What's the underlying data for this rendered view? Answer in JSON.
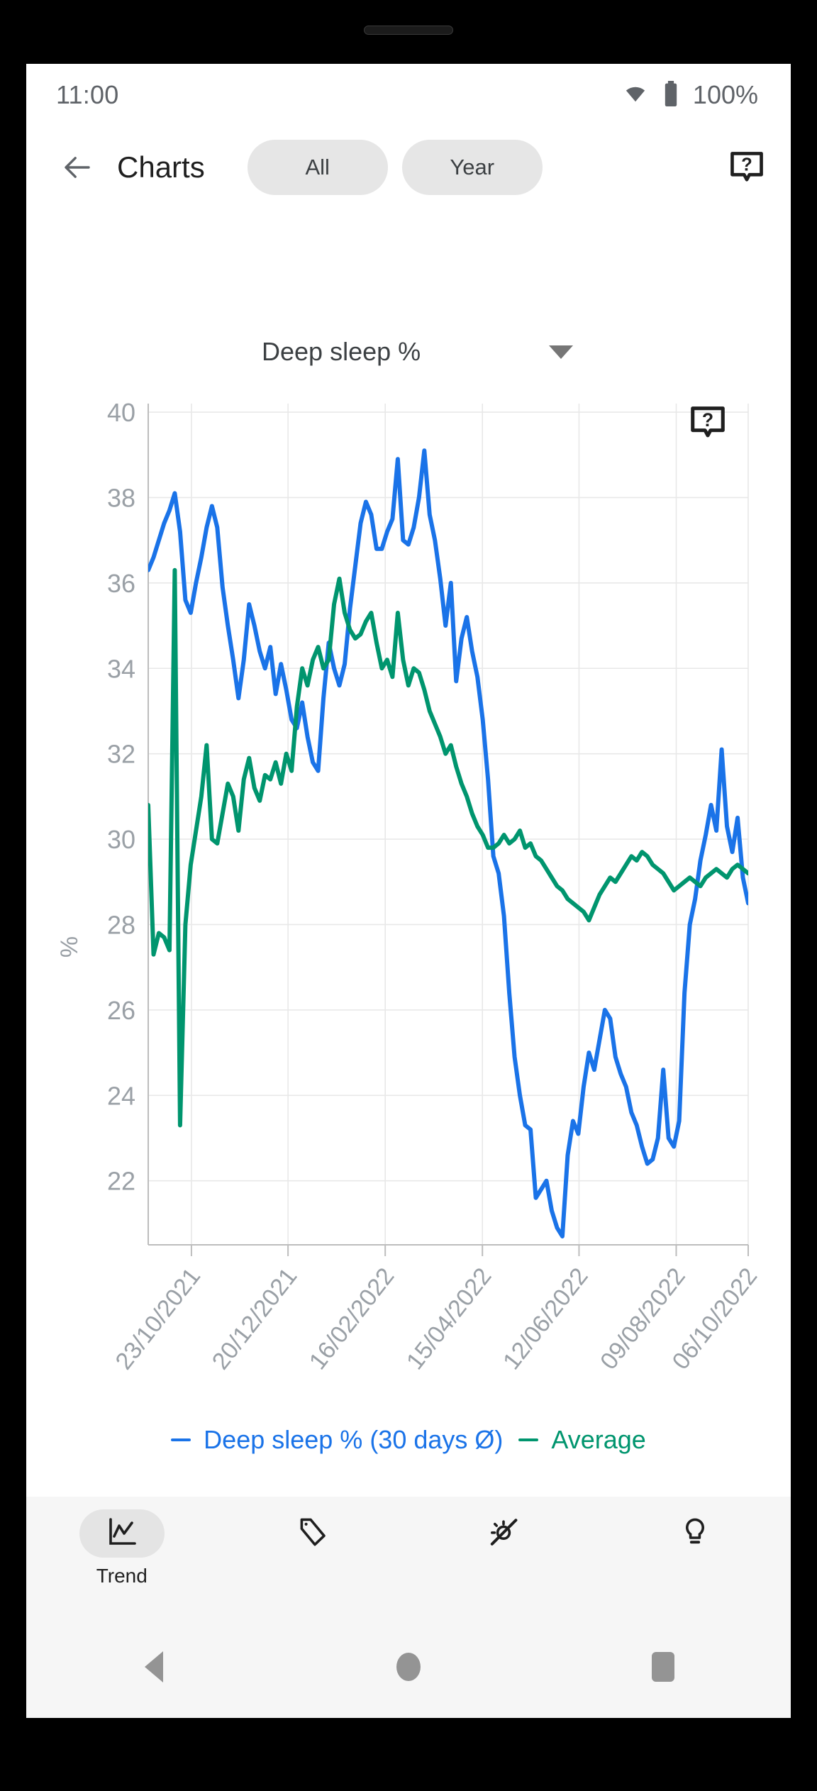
{
  "status_bar": {
    "clock": "11:00",
    "battery_percent": "100%",
    "wifi_icon": "wifi-icon",
    "battery_icon": "battery-full-icon"
  },
  "app_bar": {
    "back_icon": "back-arrow-icon",
    "title": "Charts",
    "range_buttons": [
      {
        "label": "All",
        "selected": false
      },
      {
        "label": "Year",
        "selected": false
      }
    ],
    "help_icon": "help-speech-bubble-icon"
  },
  "metric_selector": {
    "selected": "Deep sleep %",
    "caret_icon": "chevron-down-icon"
  },
  "chart_help": {
    "icon": "help-speech-bubble-icon"
  },
  "legend": [
    {
      "label": "Deep sleep % (30 days Ø)",
      "color": "#1a73e8"
    },
    {
      "label": "Average",
      "color": "#00956e"
    }
  ],
  "bottom_nav": {
    "items": [
      {
        "label": "Trend",
        "icon": "line-chart-icon",
        "selected": true
      },
      {
        "label": "",
        "icon": "tag-icon",
        "selected": false
      },
      {
        "label": "",
        "icon": "weather-sun-slash-icon",
        "selected": false
      },
      {
        "label": "",
        "icon": "lightbulb-icon",
        "selected": false
      }
    ]
  },
  "system_nav": {
    "back": "system-back-icon",
    "home": "system-home-icon",
    "recents": "system-recents-icon"
  },
  "colors": {
    "series_blue": "#1a73e8",
    "series_green": "#00956e",
    "grid": "#e8e8e8",
    "axis": "#bdbdbd",
    "tick_text": "#9aa0a6"
  },
  "chart_data": {
    "type": "line",
    "title": "Deep sleep %",
    "xlabel": "",
    "ylabel": "%",
    "ylim": [
      20.5,
      40.2
    ],
    "yticks": [
      40,
      38,
      36,
      34,
      32,
      30,
      28,
      26,
      24,
      22
    ],
    "grid": true,
    "legend_position": "bottom",
    "xticks": [
      "23/10/2021",
      "20/12/2021",
      "16/02/2022",
      "15/04/2022",
      "12/06/2022",
      "09/08/2022",
      "06/10/2022"
    ],
    "xtick_positions": [
      0.072,
      0.233,
      0.395,
      0.557,
      0.718,
      0.88,
      1.0
    ],
    "series": [
      {
        "name": "Deep sleep % (30 days Ø)",
        "color": "#1a73e8",
        "values": [
          36.3,
          36.6,
          37.0,
          37.4,
          37.7,
          38.1,
          37.2,
          35.6,
          35.3,
          36.0,
          36.6,
          37.3,
          37.8,
          37.3,
          35.9,
          35.0,
          34.2,
          33.3,
          34.2,
          35.5,
          35.0,
          34.4,
          34.0,
          34.5,
          33.4,
          34.1,
          33.5,
          32.8,
          32.6,
          33.2,
          32.4,
          31.8,
          31.6,
          33.3,
          34.6,
          34.0,
          33.6,
          34.1,
          35.4,
          36.4,
          37.4,
          37.9,
          37.6,
          36.8,
          36.8,
          37.2,
          37.5,
          38.9,
          37.0,
          36.9,
          37.3,
          38.0,
          39.1,
          37.6,
          37.0,
          36.1,
          35.0,
          36.0,
          33.7,
          34.7,
          35.2,
          34.4,
          33.8,
          32.8,
          31.4,
          29.6,
          29.2,
          28.2,
          26.4,
          24.9,
          24.0,
          23.3,
          23.2,
          21.6,
          21.8,
          22.0,
          21.3,
          20.9,
          20.7,
          22.6,
          23.4,
          23.1,
          24.2,
          25.0,
          24.6,
          25.3,
          26.0,
          25.8,
          24.9,
          24.5,
          24.2,
          23.6,
          23.3,
          22.8,
          22.4,
          22.5,
          23.0,
          24.6,
          23.0,
          22.8,
          23.4,
          26.4,
          28.0,
          28.6,
          29.5,
          30.1,
          30.8,
          30.2,
          32.1,
          30.3,
          29.7,
          30.5,
          29.1,
          28.5
        ]
      },
      {
        "name": "Average",
        "color": "#00956e",
        "values": [
          30.8,
          27.3,
          27.8,
          27.7,
          27.4,
          36.3,
          23.3,
          28.0,
          29.4,
          30.2,
          31.0,
          32.2,
          30.0,
          29.9,
          30.6,
          31.3,
          31.0,
          30.2,
          31.4,
          31.9,
          31.2,
          30.9,
          31.5,
          31.4,
          31.8,
          31.3,
          32.0,
          31.6,
          33.1,
          34.0,
          33.6,
          34.2,
          34.5,
          34.0,
          34.2,
          35.5,
          36.1,
          35.3,
          34.9,
          34.7,
          34.8,
          35.1,
          35.3,
          34.6,
          34.0,
          34.2,
          33.8,
          35.3,
          34.2,
          33.6,
          34.0,
          33.9,
          33.5,
          33.0,
          32.7,
          32.4,
          32.0,
          32.2,
          31.7,
          31.3,
          31.0,
          30.6,
          30.3,
          30.1,
          29.8,
          29.8,
          29.9,
          30.1,
          29.9,
          30.0,
          30.2,
          29.8,
          29.9,
          29.6,
          29.5,
          29.3,
          29.1,
          28.9,
          28.8,
          28.6,
          28.5,
          28.4,
          28.3,
          28.1,
          28.4,
          28.7,
          28.9,
          29.1,
          29.0,
          29.2,
          29.4,
          29.6,
          29.5,
          29.7,
          29.6,
          29.4,
          29.3,
          29.2,
          29.0,
          28.8,
          28.9,
          29.0,
          29.1,
          29.0,
          28.9,
          29.1,
          29.2,
          29.3,
          29.2,
          29.1,
          29.3,
          29.4,
          29.3,
          29.2
        ]
      }
    ]
  }
}
